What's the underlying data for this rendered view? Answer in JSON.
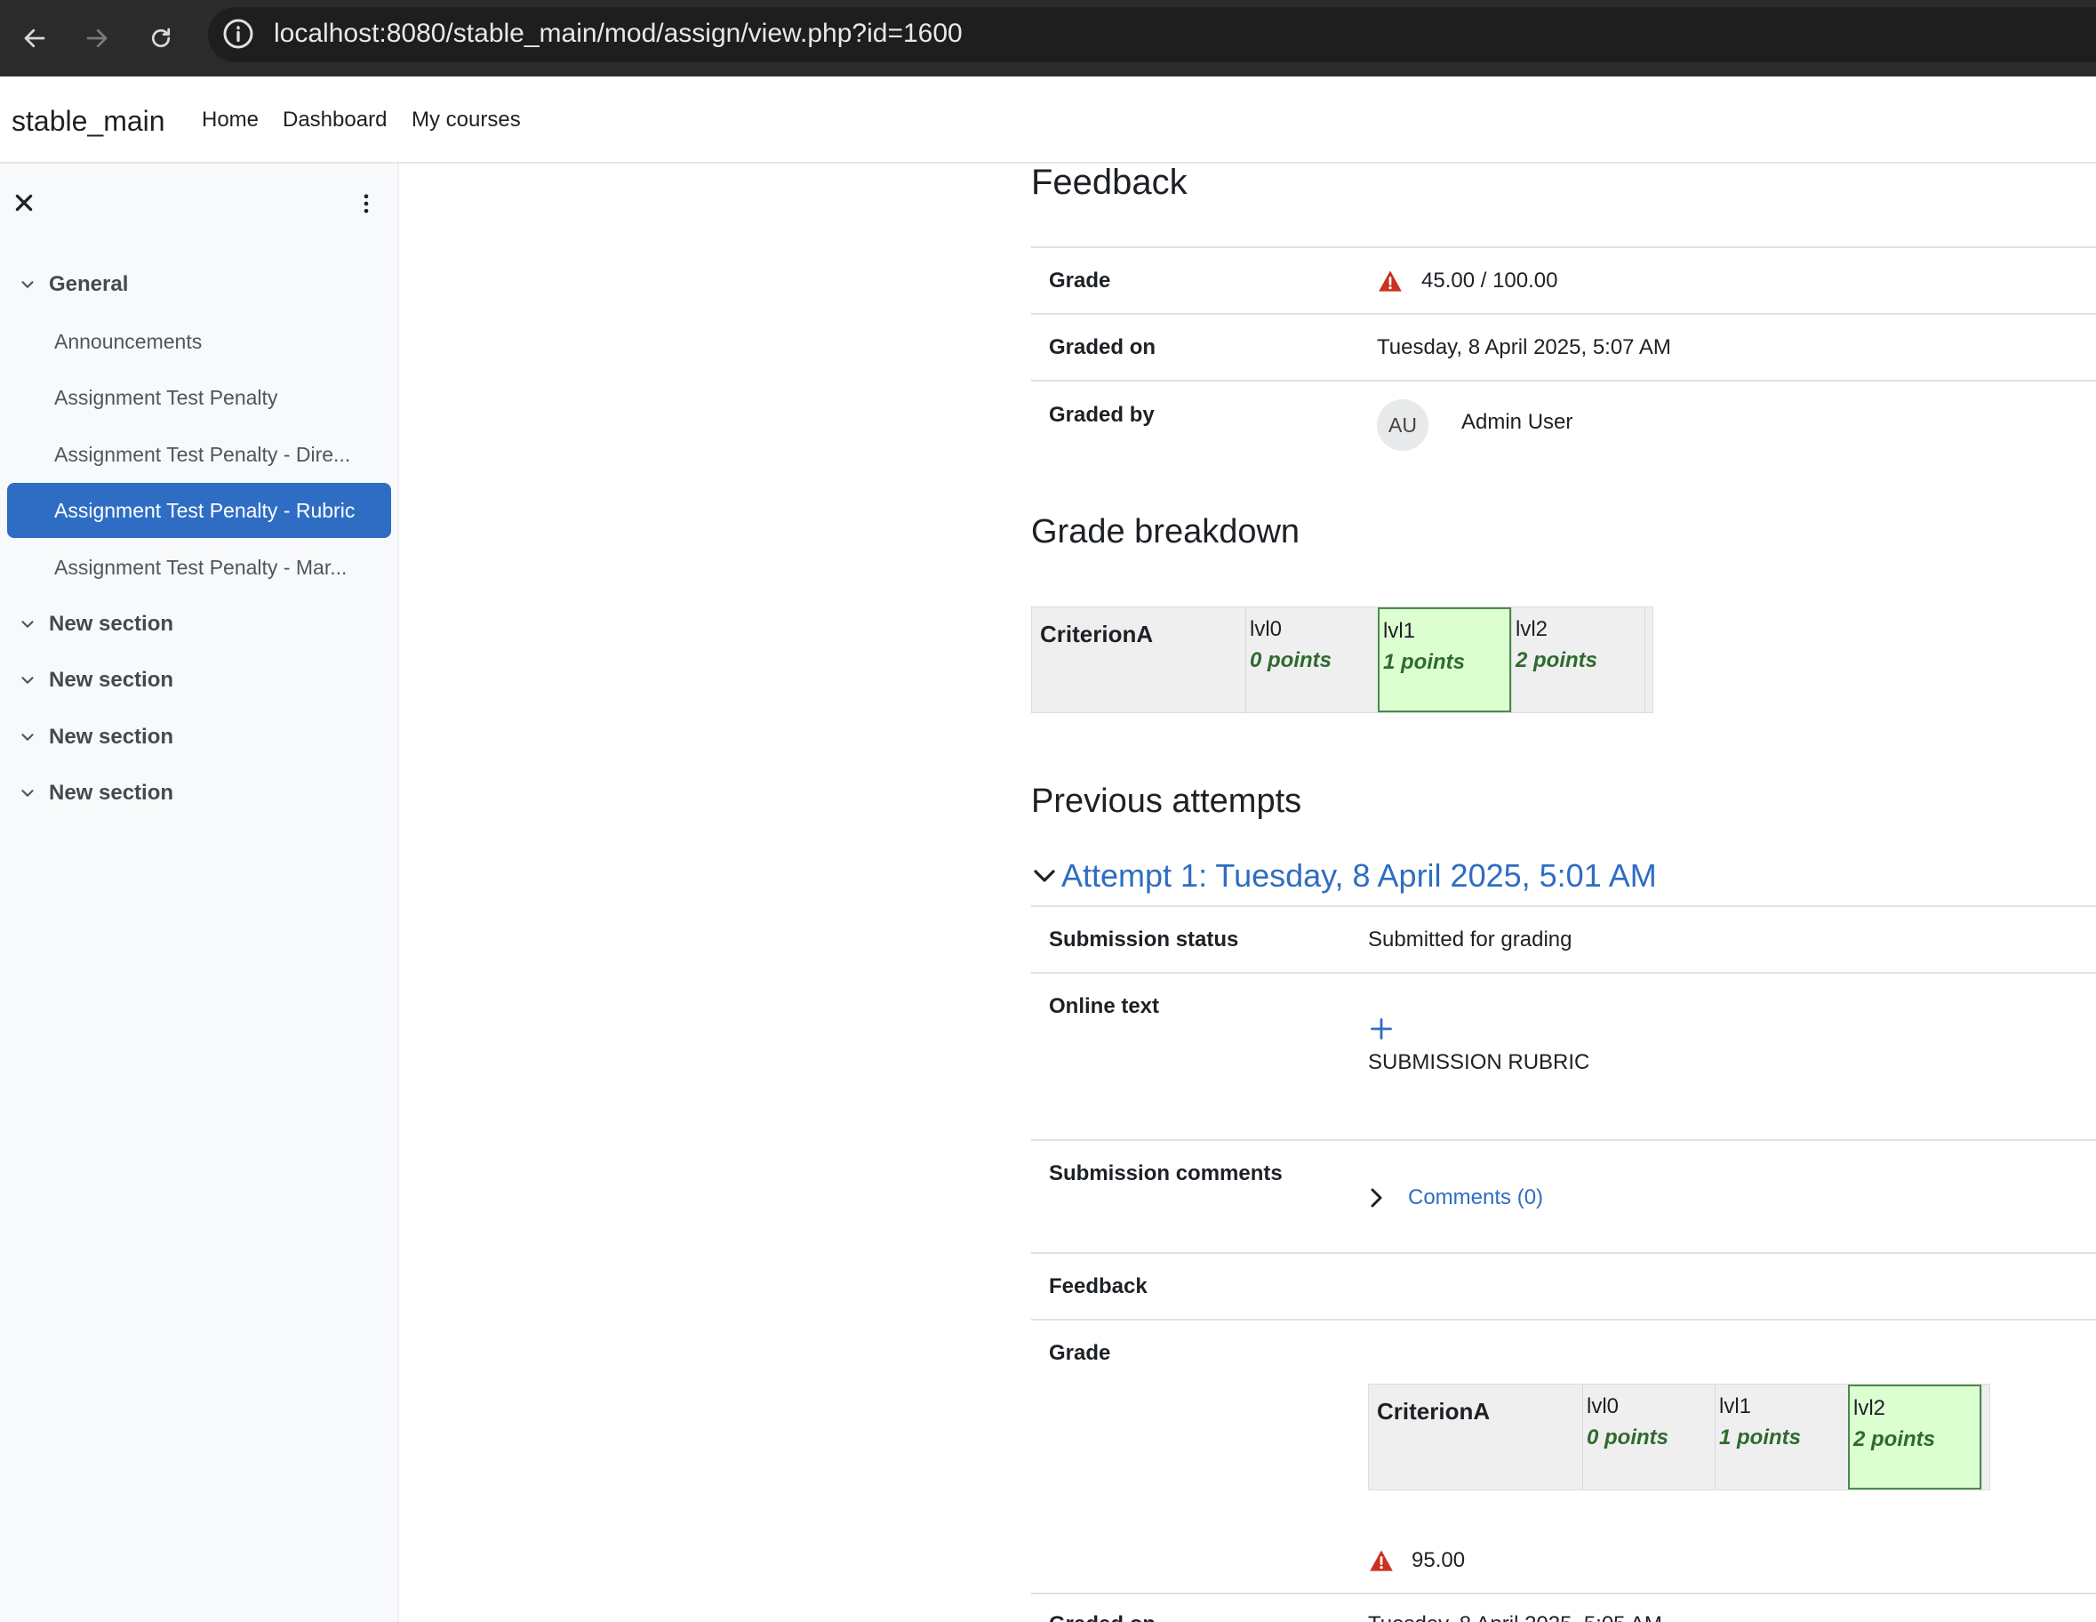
{
  "browser": {
    "url": "localhost:8080/stable_main/mod/assign/view.php?id=1600"
  },
  "navbar": {
    "brand": "stable_main",
    "links": [
      "Home",
      "Dashboard",
      "My courses"
    ]
  },
  "drawer": {
    "sections": [
      {
        "title": "General"
      },
      {
        "title": "New section"
      },
      {
        "title": "New section"
      },
      {
        "title": "New section"
      },
      {
        "title": "New section"
      }
    ],
    "activities": [
      {
        "label": "Announcements",
        "active": false
      },
      {
        "label": "Assignment Test Penalty",
        "active": false
      },
      {
        "label": "Assignment Test Penalty - Dire...",
        "active": false
      },
      {
        "label": "Assignment Test Penalty - Rubric",
        "active": true
      },
      {
        "label": "Assignment Test Penalty - Mar...",
        "active": false
      }
    ]
  },
  "feedback": {
    "heading": "Feedback",
    "grade_label": "Grade",
    "grade_value": "45.00 / 100.00",
    "graded_on_label": "Graded on",
    "graded_on_value": "Tuesday, 8 April 2025, 5:07 AM",
    "graded_by_label": "Graded by",
    "grader_initials": "AU",
    "grader_name": "Admin User"
  },
  "grade_breakdown": {
    "heading": "Grade breakdown",
    "criterion": "CriterionA",
    "levels": [
      {
        "definition": "lvl0",
        "points": "0 points",
        "selected": false
      },
      {
        "definition": "lvl1",
        "points": "1 points",
        "selected": true
      },
      {
        "definition": "lvl2",
        "points": "2 points",
        "selected": false
      }
    ]
  },
  "previous_attempts": {
    "heading": "Previous attempts",
    "attempt_title": "Attempt 1: Tuesday, 8 April 2025, 5:01 AM",
    "submission_status_label": "Submission status",
    "submission_status_value": "Submitted for grading",
    "online_text_label": "Online text",
    "online_text_value": "SUBMISSION RUBRIC",
    "submission_comments_label": "Submission comments",
    "comments_link": "Comments (0)",
    "feedback_label": "Feedback",
    "grade_label": "Grade",
    "rubric": {
      "criterion": "CriterionA",
      "levels": [
        {
          "definition": "lvl0",
          "points": "0 points",
          "selected": false
        },
        {
          "definition": "lvl1",
          "points": "1 points",
          "selected": false
        },
        {
          "definition": "lvl2",
          "points": "2 points",
          "selected": true
        }
      ]
    },
    "grade_value": "95.00",
    "graded_on_label_partial": "Graded on",
    "graded_on_value_partial": "Tuesday, 8 April 2025, 5:05 AM"
  },
  "colors": {
    "accent": "#2e6dc3",
    "warning": "#ca3120",
    "selected_level": "#dcffd1"
  }
}
